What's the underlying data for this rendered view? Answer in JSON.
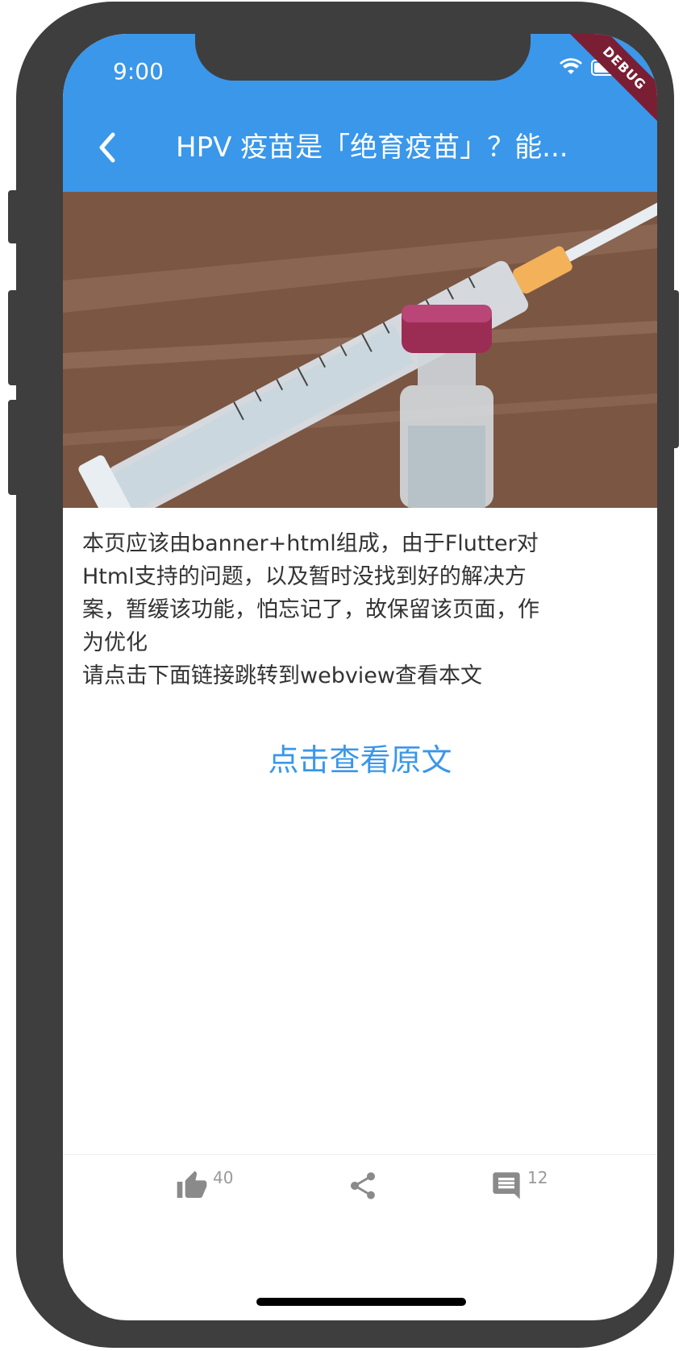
{
  "status_bar": {
    "time": "9:00",
    "debug_label": "DEBUG"
  },
  "app_bar": {
    "title": "HPV 疫苗是「绝育疫苗」？能..."
  },
  "content": {
    "paragraph_lines": [
      "本页应该由banner+html组成，由于Flutter对",
      "Html支持的问题，以及暂时没找到好的解决方",
      "案，暂缓该功能，怕忘记了，故保留该页面，作",
      "为优化",
      "请点击下面链接跳转到webview查看本文"
    ],
    "link_label": "点击查看原文"
  },
  "bottom_bar": {
    "like_count": "40",
    "comment_count": "12"
  },
  "colors": {
    "primary": "#3a97ea",
    "debug": "#7a1e34"
  }
}
